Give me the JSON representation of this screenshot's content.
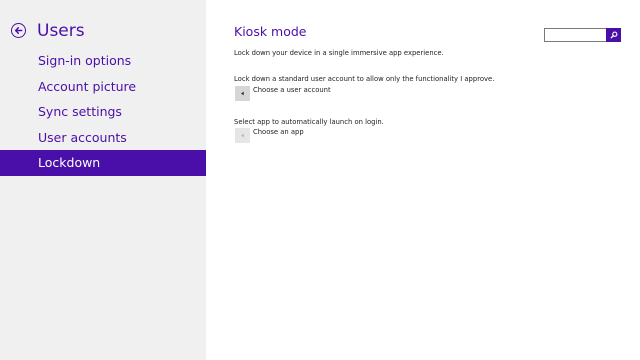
{
  "sidebar": {
    "title": "Users",
    "items": [
      {
        "label": "Sign-in options",
        "selected": false
      },
      {
        "label": "Account picture",
        "selected": false
      },
      {
        "label": "Sync settings",
        "selected": false
      },
      {
        "label": "User accounts",
        "selected": false
      },
      {
        "label": "Lockdown",
        "selected": true
      }
    ]
  },
  "main": {
    "title": "Kiosk mode",
    "intro": "Lock down your device in a single immersive app experience.",
    "account_section": {
      "description": "Lock down a standard user account to allow only the functionality I approve.",
      "picker_label": "Choose a user account"
    },
    "app_section": {
      "description": "Select app to automatically launch on login.",
      "picker_label": "Choose an app"
    }
  },
  "search": {
    "value": "",
    "placeholder": ""
  },
  "icons": {
    "back": "back-arrow-icon",
    "search": "search-icon",
    "picker": "triangle-left-icon"
  },
  "colors": {
    "accent": "#4a0fa8",
    "sidebar_bg": "#f0f0f0",
    "content_bg": "#ffffff"
  }
}
